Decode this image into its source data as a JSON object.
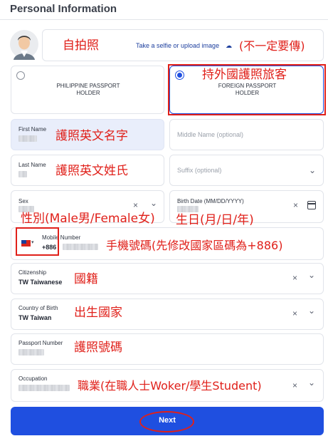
{
  "page": {
    "title": "Personal Information"
  },
  "selfie": {
    "upload_text": "Take a selfie or upload image",
    "annotation": "自拍照",
    "annotation_note": "(不一定要傳)"
  },
  "passport_type": {
    "options": [
      {
        "label_line1": "PHILIPPINE PASSPORT",
        "label_line2": "HOLDER",
        "selected": false
      },
      {
        "label_line1": "FOREIGN PASSPORT",
        "label_line2": "HOLDER",
        "selected": true
      }
    ],
    "annotation": "持外國護照旅客"
  },
  "fields": {
    "first_name": {
      "label": "First Name",
      "annotation": "護照英文名字"
    },
    "middle_name": {
      "placeholder": "Middle Name (optional)"
    },
    "last_name": {
      "label": "Last Name",
      "annotation": "護照英文姓氏"
    },
    "suffix": {
      "placeholder": "Suffix (optional)"
    },
    "sex": {
      "label": "Sex",
      "annotation": "性別(Male男/Female女)"
    },
    "birth_date": {
      "label": "Birth Date (MM/DD/YYYY)",
      "annotation": "生日(月/日/年)"
    },
    "mobile": {
      "label": "Mobile Number",
      "country_code": "+886",
      "annotation": "手機號碼(先修改國家區碼為+886)"
    },
    "citizenship": {
      "label": "Citizenship",
      "value": "TW Taiwanese",
      "annotation": "國籍"
    },
    "country_of_birth": {
      "label": "Country of Birth",
      "value": "TW Taiwan",
      "annotation": "出生國家"
    },
    "passport_number": {
      "label": "Passport Number",
      "annotation": "護照號碼"
    },
    "occupation": {
      "label": "Occupation",
      "annotation": "職業(在職人士Woker/學生Student)"
    }
  },
  "actions": {
    "next_label": "Next"
  },
  "colors": {
    "primary": "#1f4fe0",
    "annotation_red": "#e0201a",
    "filled_field": "#e9eefb"
  }
}
